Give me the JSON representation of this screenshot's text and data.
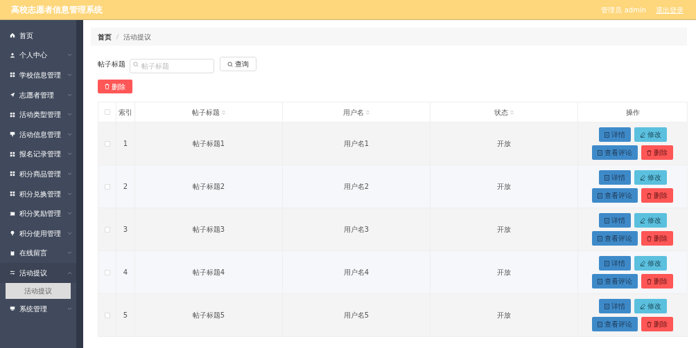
{
  "header": {
    "title": "高校志愿者信息管理系统",
    "user": "管理员 admin",
    "logout": "退出登录"
  },
  "sidebar": {
    "items": [
      {
        "label": "首页",
        "kind": "link"
      },
      {
        "label": "个人中心",
        "kind": "menu",
        "expanded": false
      },
      {
        "label": "学校信息管理",
        "kind": "menu",
        "expanded": false
      },
      {
        "label": "志愿者管理",
        "kind": "menu",
        "expanded": false
      },
      {
        "label": "活动类型管理",
        "kind": "menu",
        "expanded": false
      },
      {
        "label": "活动信息管理",
        "kind": "menu",
        "expanded": false
      },
      {
        "label": "报名记录管理",
        "kind": "menu",
        "expanded": false
      },
      {
        "label": "积分商品管理",
        "kind": "menu",
        "expanded": false
      },
      {
        "label": "积分兑换管理",
        "kind": "menu",
        "expanded": false
      },
      {
        "label": "积分奖励管理",
        "kind": "menu",
        "expanded": false
      },
      {
        "label": "积分使用管理",
        "kind": "menu",
        "expanded": false
      },
      {
        "label": "在线留言",
        "kind": "menu",
        "expanded": false
      },
      {
        "label": "活动提议",
        "kind": "menu",
        "expanded": true,
        "children": [
          {
            "label": "活动提议",
            "selected": true
          }
        ]
      },
      {
        "label": "系统管理",
        "kind": "menu",
        "expanded": false
      }
    ]
  },
  "breadcrumb": [
    "首页",
    "活动提议"
  ],
  "search": {
    "label": "帖子标题",
    "placeholder": "帖子标题",
    "button": "查询"
  },
  "delete_button": "删除",
  "table": {
    "all_checked": false,
    "columns": [
      {
        "label": "索引",
        "sortable": false
      },
      {
        "label": "帖子标题",
        "sortable": true
      },
      {
        "label": "用户名",
        "sortable": true
      },
      {
        "label": "状态",
        "sortable": true
      },
      {
        "label": "操作",
        "sortable": false
      }
    ],
    "rows": [
      {
        "checked": false,
        "index": "1",
        "title": "帖子标题1",
        "user": "用户名1",
        "status": "开放",
        "actions": [
          "详情",
          "修改",
          "查看评论",
          "删除"
        ]
      },
      {
        "checked": false,
        "index": "2",
        "title": "帖子标题2",
        "user": "用户名2",
        "status": "开放",
        "actions": [
          "详情",
          "修改",
          "查看评论",
          "删除"
        ]
      },
      {
        "checked": false,
        "index": "3",
        "title": "帖子标题3",
        "user": "用户名3",
        "status": "开放",
        "actions": [
          "详情",
          "修改",
          "查看评论",
          "删除"
        ]
      },
      {
        "checked": false,
        "index": "4",
        "title": "帖子标题4",
        "user": "用户名4",
        "status": "开放",
        "actions": [
          "详情",
          "修改",
          "查看评论",
          "删除"
        ]
      },
      {
        "checked": false,
        "index": "5",
        "title": "帖子标题5",
        "user": "用户名5",
        "status": "开放",
        "actions": [
          "详情",
          "修改",
          "查看评论",
          "删除"
        ]
      }
    ]
  }
}
